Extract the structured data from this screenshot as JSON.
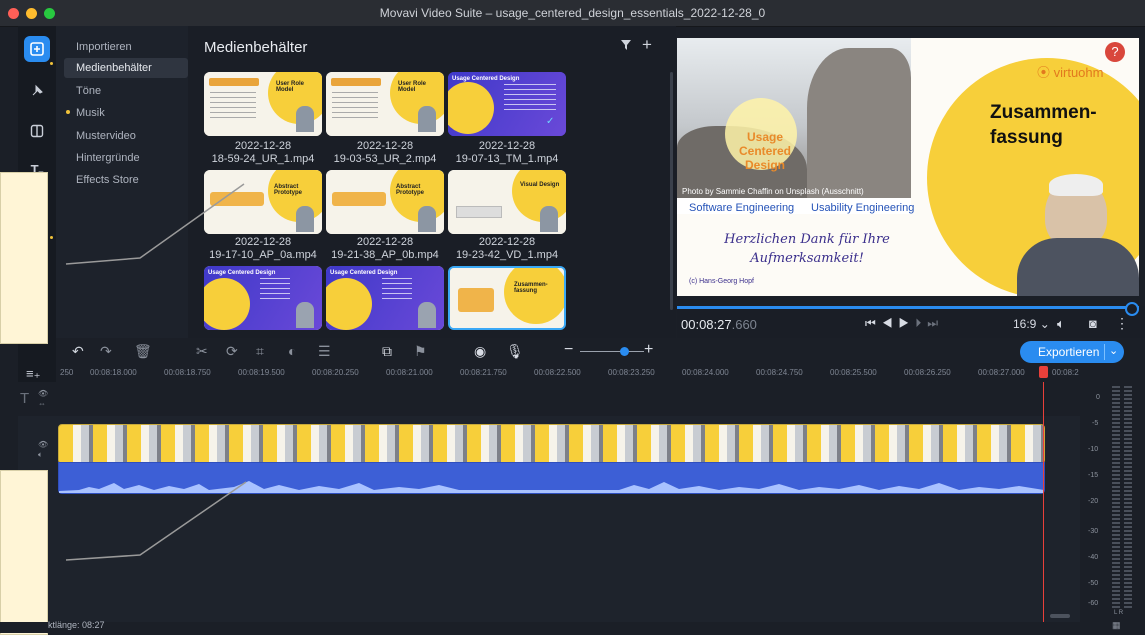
{
  "window": {
    "title": "Movavi Video Suite – usage_centered_design_essentials_2022-12-28_0"
  },
  "sidebar": {
    "icons": [
      "import-icon",
      "pin-icon",
      "transition-icon",
      "titles-icon"
    ],
    "items": [
      {
        "label": "Importieren"
      },
      {
        "label": "Medienbehälter"
      },
      {
        "label": "Töne"
      },
      {
        "label": "Musik"
      },
      {
        "label": "Mustervideo"
      },
      {
        "label": "Hintergründe"
      },
      {
        "label": "Effects Store"
      }
    ]
  },
  "media": {
    "title": "Medienbehälter",
    "items": [
      {
        "date": "2022-12-28",
        "name": "18-59-24_UR_1.mp4",
        "slide_title": "User Role Model"
      },
      {
        "date": "2022-12-28",
        "name": "19-03-53_UR_2.mp4",
        "slide_title": "User Role Model"
      },
      {
        "date": "2022-12-28",
        "name": "19-07-13_TM_1.mp4",
        "slide_title": "Usage Centered Design"
      },
      {
        "date": "2022-12-28",
        "name": "19-17-10_AP_0a.mp4",
        "slide_title": "Abstract Prototype"
      },
      {
        "date": "2022-12-28",
        "name": "19-21-38_AP_0b.mp4",
        "slide_title": "Abstract Prototype"
      },
      {
        "date": "2022-12-28",
        "name": "19-23-42_VD_1.mp4",
        "slide_title": "Visual Design"
      },
      {
        "slide_title": "Usage Centered Design"
      },
      {
        "slide_title": "Usage Centered Design"
      },
      {
        "slide_title": "Zusammen-fassung"
      }
    ]
  },
  "preview": {
    "brand": "virtuohm",
    "heading_line1": "Zusammen-",
    "heading_line2": "fassung",
    "usage1": "Usage",
    "usage2": "Centered",
    "usage3": "Design",
    "photo_credit": "Photo by Sammie Chaffin on Unsplash (Ausschnitt)",
    "left_label": "Software Engineering",
    "right_label": "Usability Engineering",
    "thanks1": "Herzlichen Dank für Ihre",
    "thanks2": "Aufmerksamkeit!",
    "copyright": "(c) Hans-Georg Hopf",
    "help": "?"
  },
  "player": {
    "timecode": "00:08:27",
    "frames": ".660",
    "aspect": "16:9 ⌄"
  },
  "toolbar": {
    "export_label": "Exportieren"
  },
  "ruler": {
    "ticks": [
      "250",
      "00:08:18.000",
      "00:08:18.750",
      "00:08:19.500",
      "00:08:20.250",
      "00:08:21.000",
      "00:08:21.750",
      "00:08:22.500",
      "00:08:23.250",
      "00:08:24.000",
      "00:08:24.750",
      "00:08:25.500",
      "00:08:26.250",
      "00:08:27.000",
      "00:08:2"
    ]
  },
  "meter": {
    "labels": [
      "0",
      "-5",
      "-10",
      "-15",
      "-20",
      "-30",
      "-40",
      "-50",
      "-60"
    ],
    "lr": "L R"
  },
  "status": {
    "text": "ktlänge: 08:27"
  },
  "colors": {
    "accent": "#2a8cf0",
    "playhead": "#e8403a",
    "slide_yellow": "#f7cf3a",
    "track_blue": "#3d5fd6"
  }
}
